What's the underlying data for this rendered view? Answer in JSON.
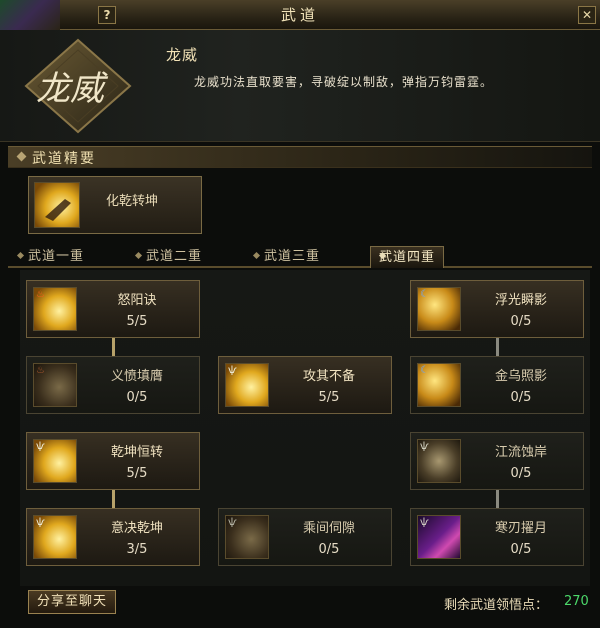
{
  "window": {
    "title": "武道",
    "help_label": "?",
    "close_label": "✕"
  },
  "header": {
    "emblem_text": "龙威",
    "skill_name": "龙威",
    "description": "龙威功法直取要害，寻破绽以制敌，弹指万钧雷霆。"
  },
  "section": {
    "title": "武道精要"
  },
  "main_skill": {
    "label": "化乾转坤",
    "icon": "golden-hand-icon"
  },
  "tabs": [
    {
      "label": "武道一重",
      "active": false
    },
    {
      "label": "武道二重",
      "active": false
    },
    {
      "label": "武道三重",
      "active": false
    },
    {
      "label": "武道四重",
      "active": true
    }
  ],
  "nodes": [
    {
      "name": "怒阳诀",
      "level": "5/5",
      "icon": "fire-fist-icon"
    },
    {
      "name": "浮光瞬影",
      "level": "0/5",
      "icon": "moon-slash-icon"
    },
    {
      "name": "义愤填膺",
      "level": "0/5",
      "icon": "fire-fist-icon"
    },
    {
      "name": "攻其不备",
      "level": "5/5",
      "icon": "golden-fist-icon"
    },
    {
      "name": "金乌照影",
      "level": "0/5",
      "icon": "moon-sun-icon"
    },
    {
      "name": "乾坤恒转",
      "level": "5/5",
      "icon": "golden-palm-icon"
    },
    {
      "name": "江流蚀岸",
      "level": "0/5",
      "icon": "palm-icon"
    },
    {
      "name": "意决乾坤",
      "level": "3/5",
      "icon": "golden-palm-icon"
    },
    {
      "name": "乘间伺隙",
      "level": "0/5",
      "icon": "fist-icon"
    },
    {
      "name": "寒刃擢月",
      "level": "0/5",
      "icon": "purple-blade-icon"
    }
  ],
  "footer": {
    "share_label": "分享至聊天",
    "points_label": "剩余武道领悟点：",
    "points_value": "270"
  },
  "colors": {
    "accent_gold": "#b7a26a",
    "points_green": "#4cd86a"
  }
}
